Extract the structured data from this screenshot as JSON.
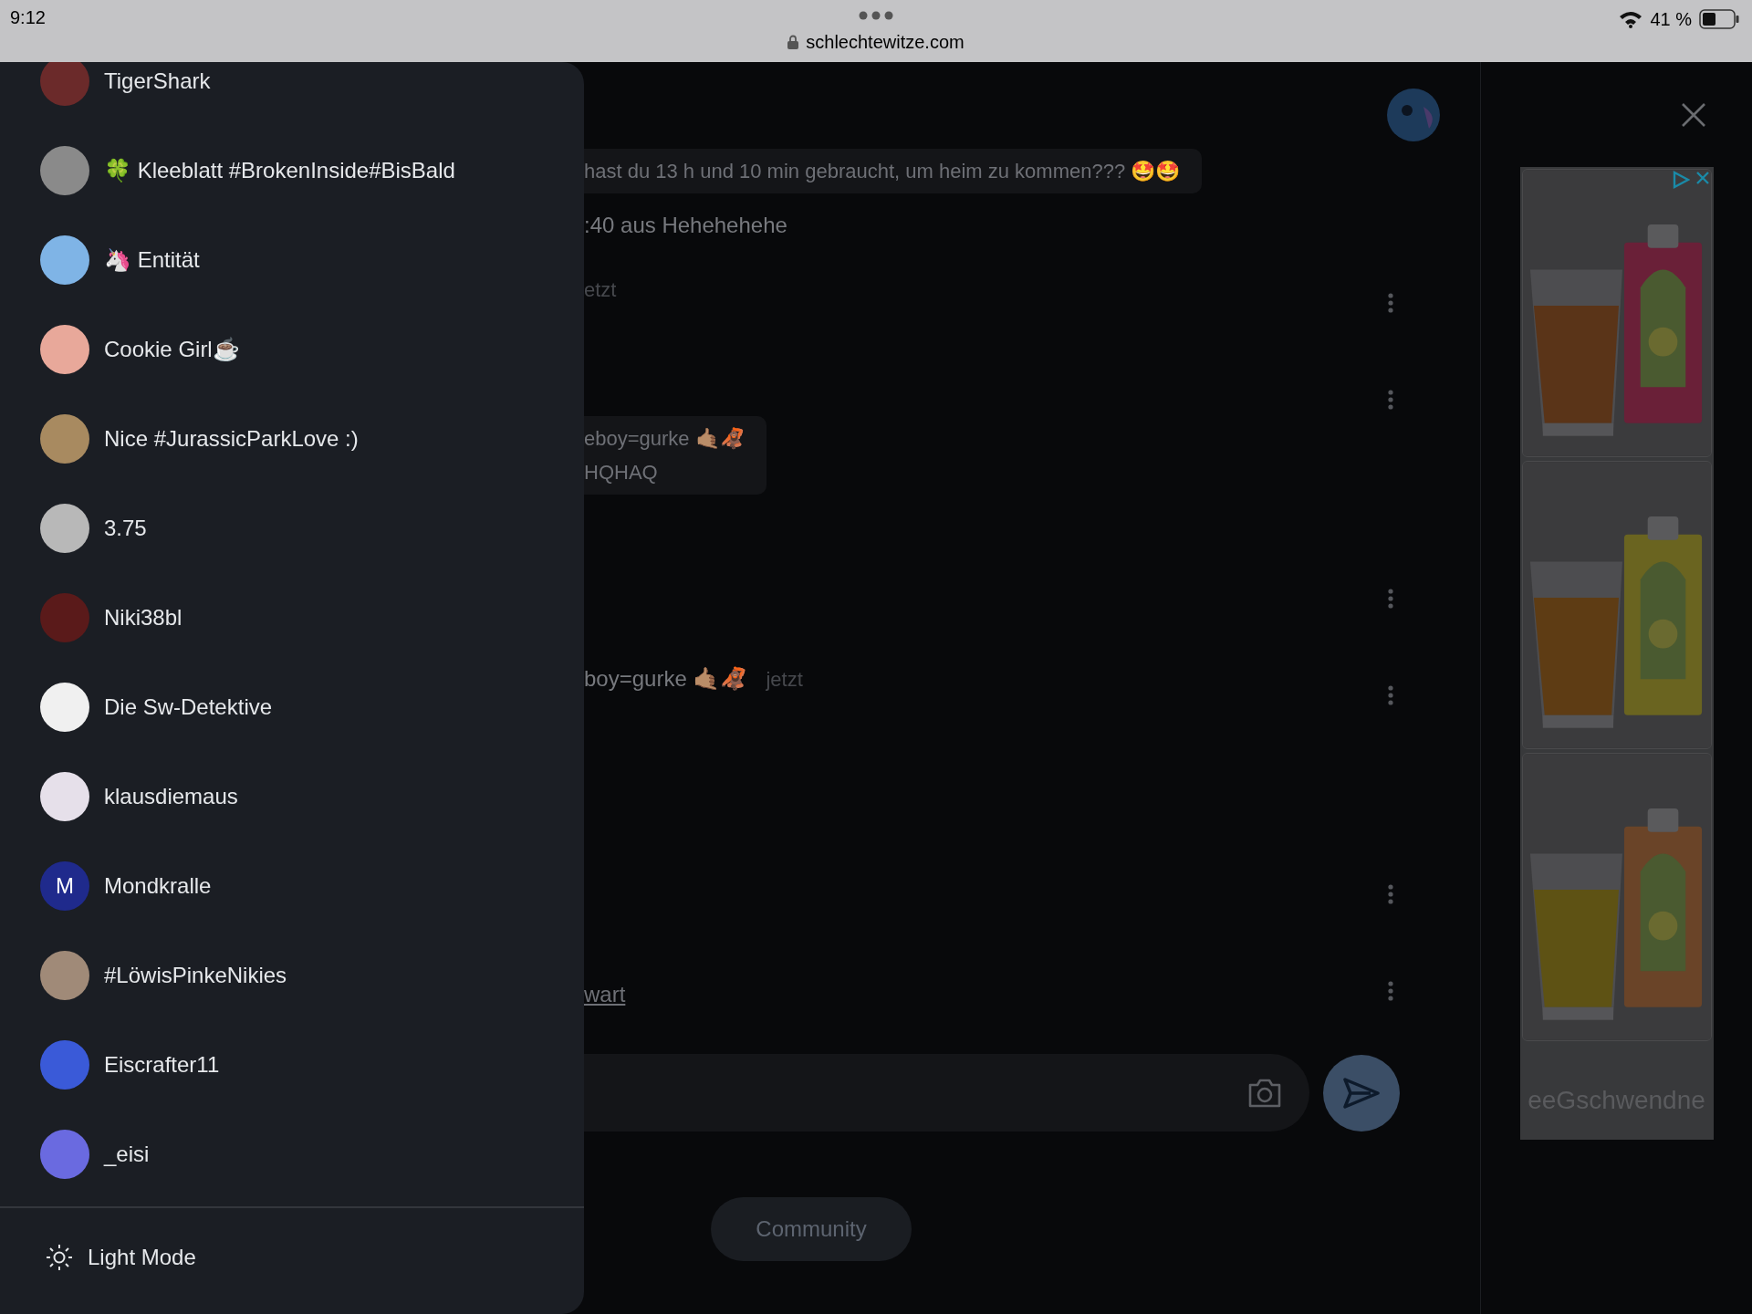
{
  "status_bar": {
    "time": "9:12",
    "battery": "41 %"
  },
  "browser": {
    "url": "schlechtewitze.com"
  },
  "drawer": {
    "users": [
      {
        "name": "TigerShark"
      },
      {
        "name": "🍀 Kleeblatt #BrokenInside#BisBald"
      },
      {
        "name": "🦄 Entität"
      },
      {
        "name": "Cookie Girl☕"
      },
      {
        "name": "Nice #JurassicParkLove :)"
      },
      {
        "name": "3.75"
      },
      {
        "name": "Niki38bl"
      },
      {
        "name": "Die Sw-Detektive"
      },
      {
        "name": "klausdiemaus"
      },
      {
        "name": "Mondkralle",
        "avatar": {
          "kind": "letter",
          "letter": "M",
          "color": "#1f2a8c"
        }
      },
      {
        "name": "#LöwisPinkeNikies"
      },
      {
        "name": "Eiscrafter11"
      },
      {
        "name": "_eisi"
      }
    ],
    "theme_toggle": "Light Mode"
  },
  "chat": {
    "messages": [
      {
        "kind": "bubble",
        "lines": [
          "hast du 13 h und 10 min gebraucht, um heim zu kommen??? 🤩🤩"
        ]
      },
      {
        "kind": "text",
        "text": ":40 aus Hehehehehe"
      },
      {
        "kind": "time",
        "text": "etzt"
      },
      {
        "kind": "bubble",
        "lines": [
          "eboy=gurke 🤙🏽🦧",
          "HQHAQ"
        ]
      },
      {
        "kind": "text_time",
        "text": "boy=gurke 🤙🏽🦧",
        "time": "jetzt"
      },
      {
        "kind": "link",
        "text": "wart"
      }
    ]
  },
  "community_button": "Community",
  "ad": {
    "brand_text": "eeGschwendne"
  }
}
